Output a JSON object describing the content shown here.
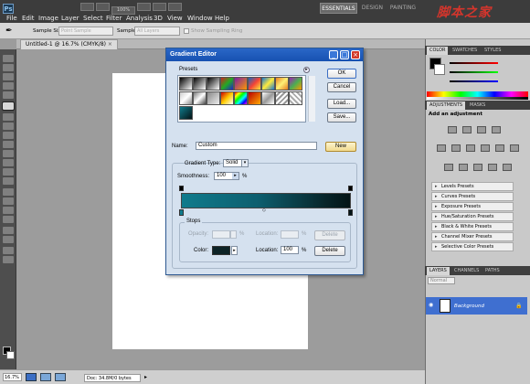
{
  "menubar": {
    "app_logo": "Ps",
    "items": [
      "File",
      "Edit",
      "Image",
      "Layer",
      "Select",
      "Filter",
      "Analysis",
      "3D",
      "View",
      "Window",
      "Help"
    ],
    "zoom": "100%",
    "workspaces": [
      "ESSENTIALS",
      "DESIGN",
      "PAINTING"
    ],
    "watermark": "脚本之家"
  },
  "options_bar": {
    "sample_size_label": "Sample Size:",
    "sample_size_value": "Point Sample",
    "sample_label": "Sample:",
    "sample_value": "All Layers",
    "show_ring_label": "Show Sampling Ring"
  },
  "document": {
    "tab_title": "Untitled-1 @ 16.7% (CMYK/8)",
    "status_zoom": "16.7%",
    "status_size": "Doc: 34.8M/0 bytes"
  },
  "panels": {
    "color_tabs": [
      "COLOR",
      "SWATCHES",
      "STYLES"
    ],
    "adjust_tabs": [
      "ADJUSTMENTS",
      "MASKS"
    ],
    "adjust_title": "Add an adjustment",
    "presets": [
      "Levels Presets",
      "Curves Presets",
      "Exposure Presets",
      "Hue/Saturation Presets",
      "Black & White Presets",
      "Channel Mixer Presets",
      "Selective Color Presets"
    ],
    "layer_tabs": [
      "LAYERS",
      "CHANNELS",
      "PATHS"
    ],
    "blend_mode": "Normal",
    "layer_name": "Background"
  },
  "dialog": {
    "title": "Gradient Editor",
    "presets_label": "Presets",
    "buttons": {
      "ok": "OK",
      "cancel": "Cancel",
      "load": "Load...",
      "save": "Save...",
      "new": "New",
      "delete_opacity": "Delete",
      "delete_color": "Delete"
    },
    "name_label": "Name:",
    "name_value": "Custom",
    "gradient_type_label": "Gradient Type:",
    "gradient_type_value": "Solid",
    "smoothness_label": "Smoothness:",
    "smoothness_value": "100",
    "percent": "%",
    "stops_label": "Stops",
    "opacity_label": "Opacity:",
    "location_label": "Location:",
    "color_label": "Color:",
    "color_location_value": "100",
    "gradient_colors": [
      "#107b8c",
      "#0d5f6f",
      "#08262b",
      "#031315"
    ]
  }
}
